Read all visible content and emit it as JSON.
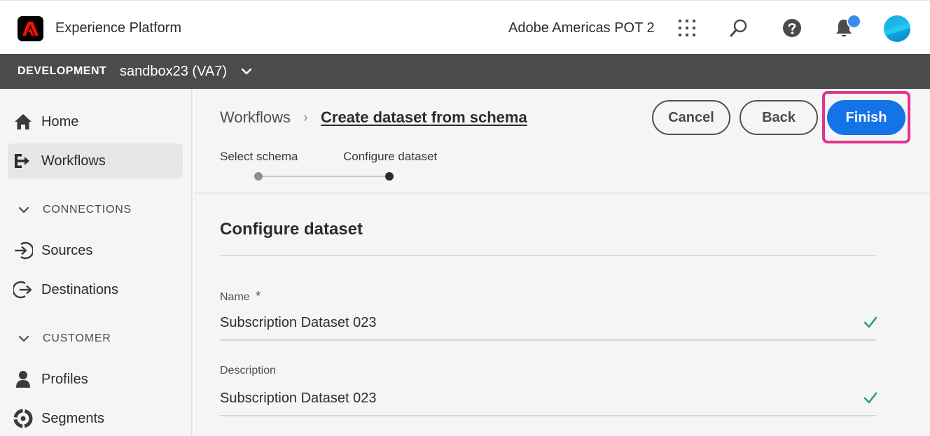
{
  "header": {
    "app_title": "Experience Platform",
    "org_name": "Adobe Americas POT 2",
    "icons": [
      "apps-grid-icon",
      "search-icon",
      "help-icon",
      "bell-icon",
      "avatar"
    ],
    "notification_color": "#378ef0"
  },
  "sandbox": {
    "environment": "DEVELOPMENT",
    "name": "sandbox23 (VA7)"
  },
  "sidebar": {
    "items": [
      {
        "label": "Home",
        "icon": "home-icon",
        "selected": false
      },
      {
        "label": "Workflows",
        "icon": "workflows-icon",
        "selected": true
      }
    ],
    "sections": [
      {
        "label": "CONNECTIONS",
        "items": [
          {
            "label": "Sources",
            "icon": "sources-icon"
          },
          {
            "label": "Destinations",
            "icon": "destinations-icon"
          }
        ]
      },
      {
        "label": "CUSTOMER",
        "items": [
          {
            "label": "Profiles",
            "icon": "profiles-icon"
          },
          {
            "label": "Segments",
            "icon": "segments-icon"
          }
        ]
      }
    ]
  },
  "main": {
    "breadcrumb": {
      "root": "Workflows",
      "separator": "›",
      "current": "Create dataset from schema"
    },
    "buttons": {
      "cancel": "Cancel",
      "back": "Back",
      "finish": "Finish"
    },
    "steps": [
      {
        "label": "Select schema",
        "state": "completed"
      },
      {
        "label": "Configure dataset",
        "state": "current"
      }
    ],
    "section_title": "Configure dataset",
    "fields": [
      {
        "label": "Name",
        "required_mark": "*",
        "value": "Subscription Dataset 023",
        "valid": true
      },
      {
        "label": "Description",
        "required_mark": "",
        "value": "Subscription Dataset 023",
        "valid": true
      }
    ]
  },
  "colors": {
    "accent": "#1473e6",
    "highlight": "#e0338f",
    "sandbox_bar": "#4b4b4b",
    "valid": "#2d9d78"
  }
}
